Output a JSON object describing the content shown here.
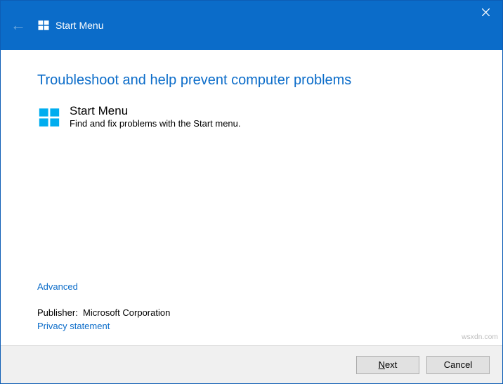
{
  "titlebar": {
    "title": "Start Menu"
  },
  "main": {
    "heading": "Troubleshoot and help prevent computer problems",
    "item": {
      "title": "Start Menu",
      "description": "Find and fix problems with the Start menu."
    },
    "advanced_label": "Advanced",
    "publisher_label": "Publisher:",
    "publisher_value": "Microsoft Corporation",
    "privacy_label": "Privacy statement"
  },
  "footer": {
    "next_prefix": "N",
    "next_rest": "ext",
    "cancel_label": "Cancel"
  },
  "watermark": "wsxdn.com"
}
